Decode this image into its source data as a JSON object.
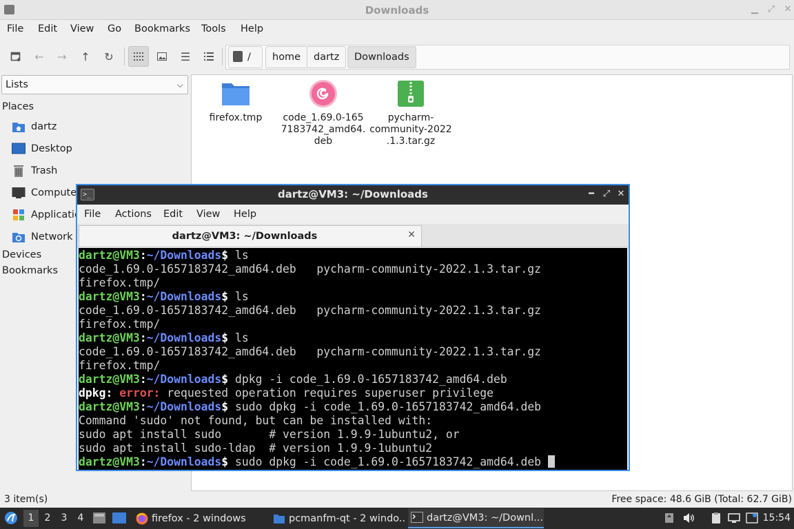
{
  "window": {
    "title": "Downloads"
  },
  "menu": [
    "File",
    "Edit",
    "View",
    "Go",
    "Bookmarks",
    "Tools",
    "Help"
  ],
  "toolbar": {
    "buttons": [
      "new-tab-icon",
      "back-arrow-icon",
      "forward-arrow-icon",
      "up-arrow-icon",
      "reload-icon",
      "icon-view-icon",
      "thumbnail-view-icon",
      "compact-view-icon",
      "detailed-list-icon"
    ]
  },
  "path": {
    "root": "/",
    "crumbs": [
      "home",
      "dartz",
      "Downloads"
    ]
  },
  "sidebar": {
    "mode": "Lists",
    "places_heading": "Places",
    "items": [
      {
        "label": "dartz",
        "icon": "home-folder-icon"
      },
      {
        "label": "Desktop",
        "icon": "desktop-icon"
      },
      {
        "label": "Trash",
        "icon": "trash-icon"
      },
      {
        "label": "Computer",
        "icon": "computer-icon"
      },
      {
        "label": "Applications",
        "icon": "applications-icon"
      },
      {
        "label": "Network",
        "icon": "network-icon"
      }
    ],
    "devices_heading": "Devices",
    "bookmarks_heading": "Bookmarks"
  },
  "files": [
    {
      "name": "firefox.tmp",
      "icon": "folder-icon"
    },
    {
      "name": "code_1.69.0-165\n7183742_amd64.\ndeb",
      "icon": "debian-package-icon"
    },
    {
      "name": "pycharm-\ncommunity-2022\n.1.3.tar.gz",
      "icon": "archive-icon"
    }
  ],
  "status": {
    "items": "3 item(s)",
    "free": "Free space: 48.6 GiB (Total: 62.7 GiB)"
  },
  "terminal": {
    "title": "dartz@VM3: ~/Downloads",
    "menu": [
      "File",
      "Actions",
      "Edit",
      "View",
      "Help"
    ],
    "tab": "dartz@VM3: ~/Downloads",
    "prompt_user": "dartz@VM3",
    "prompt_path": "~/Downloads",
    "lines": [
      {
        "type": "cmd",
        "text": "ls"
      },
      {
        "type": "out",
        "text": "code_1.69.0-1657183742_amd64.deb   pycharm-community-2022.1.3.tar.gz"
      },
      {
        "type": "out",
        "text": "firefox.tmp/"
      },
      {
        "type": "cmd",
        "text": "ls"
      },
      {
        "type": "out",
        "text": "code_1.69.0-1657183742_amd64.deb   pycharm-community-2022.1.3.tar.gz"
      },
      {
        "type": "out",
        "text": "firefox.tmp/"
      },
      {
        "type": "cmd",
        "text": "ls"
      },
      {
        "type": "out",
        "text": "code_1.69.0-1657183742_amd64.deb   pycharm-community-2022.1.3.tar.gz"
      },
      {
        "type": "out",
        "text": "firefox.tmp/"
      },
      {
        "type": "cmd",
        "text": "dpkg -i code_1.69.0-1657183742_amd64.deb"
      },
      {
        "type": "err",
        "prog": "dpkg:",
        "label": "error:",
        "text": "requested operation requires superuser privilege"
      },
      {
        "type": "cmd",
        "text": "sudo dpkg -i code_1.69.0-1657183742_amd64.deb"
      },
      {
        "type": "out",
        "text": "Command 'sudo' not found, but can be installed with:"
      },
      {
        "type": "out",
        "text": "sudo apt install sudo       # version 1.9.9-1ubuntu2, or"
      },
      {
        "type": "out",
        "text": "sudo apt install sudo-ldap  # version 1.9.9-1ubuntu2"
      },
      {
        "type": "cmd",
        "text": "sudo dpkg -i code_1.69.0-1657183742_amd64.deb",
        "cursor": true
      }
    ]
  },
  "taskbar": {
    "workspaces": [
      "1",
      "2",
      "3",
      "4"
    ],
    "active_workspace": "1",
    "tasks": [
      {
        "label": "firefox - 2 windows",
        "icon": "firefox-icon"
      },
      {
        "label": "pcmanfm-qt - 2 windo...",
        "icon": "file-manager-icon"
      },
      {
        "label": "dartz@VM3: ~/Downl...",
        "icon": "terminal-icon"
      }
    ],
    "clock": "15:54"
  }
}
